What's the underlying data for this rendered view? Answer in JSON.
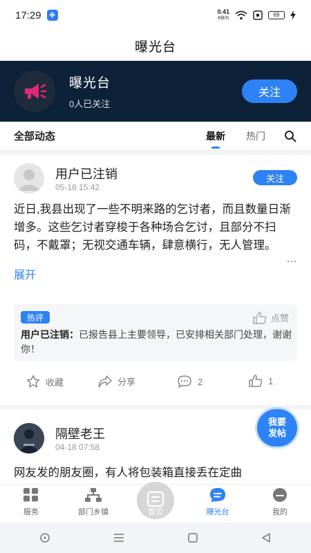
{
  "status": {
    "time": "17:29",
    "net_speed": "0.41",
    "net_unit": "KB/S",
    "battery": "69"
  },
  "app_bar": {
    "title": "曝光台"
  },
  "hero": {
    "name": "曝光台",
    "followers": "0人已关注",
    "follow_label": "关注"
  },
  "tabs": {
    "section_title": "全部动态",
    "latest": "最新",
    "hot": "热门"
  },
  "posts": [
    {
      "author": "用户已注销",
      "time": "05-18 15:42",
      "follow_label": "关注",
      "body": "近日,我县出现了一些不明来路的乞讨者，而且数量日渐增多。这些乞讨者穿梭于各种场合乞讨，且部分不扫码，不戴罩；无视交通车辆，肆意横行，无人管理。",
      "more": "…",
      "expand_label": "展开",
      "reply": {
        "badge": "热评",
        "like_label": "点赞",
        "author": "用户已注销：",
        "text": "已报告县上主要领导，已安排相关部门处理，谢谢你！"
      },
      "actions": {
        "favorite": "收藏",
        "share": "分享",
        "comments": "2",
        "likes": "1"
      }
    },
    {
      "author": "隔壁老王",
      "time": "04-18 07:58",
      "body": "网友发的朋友圈，有人将包装箱直接丢在定曲"
    }
  ],
  "fab": {
    "line1": "我要",
    "line2": "发帖"
  },
  "bottom_nav": [
    {
      "label": "服务"
    },
    {
      "label": "部门乡镇"
    },
    {
      "label": "首页"
    },
    {
      "label": "曝光台"
    },
    {
      "label": "我的"
    }
  ],
  "colors": {
    "accent": "#2d82f5",
    "hero_bg": "#0d2238",
    "logo_pink": "#e0287a"
  }
}
